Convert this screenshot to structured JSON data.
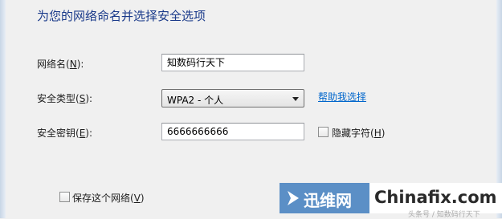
{
  "heading": "为您的网络命名并选择安全选项",
  "network_name": {
    "label": "网络名",
    "hotkey": "N",
    "value": "知数码行天下"
  },
  "security_type": {
    "label": "安全类型",
    "hotkey": "S",
    "value": "WPA2 - 个人"
  },
  "help_link": "帮助我选择",
  "security_key": {
    "label": "安全密钥",
    "hotkey": "E",
    "value": "6666666666"
  },
  "hide_chars": {
    "label": "隐藏字符",
    "hotkey": "H",
    "checked": false
  },
  "save_network": {
    "label": "保存这个网络",
    "hotkey": "V",
    "checked": false
  },
  "watermark": {
    "brand": "迅维网",
    "site": "Chinafix.com",
    "small": "头条号 / 知数码行天下"
  }
}
